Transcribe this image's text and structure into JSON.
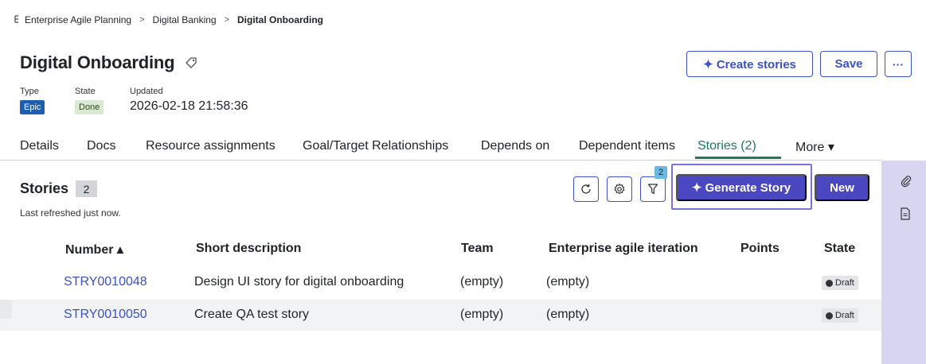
{
  "breadcrumb": {
    "items": [
      "Enterprise Agile Planning",
      "Digital Banking",
      "Digital Onboarding"
    ],
    "separator": ">"
  },
  "header": {
    "title": "Digital Onboarding",
    "create_stories_label": "✦ Create stories",
    "save_label": "Save",
    "more_label": "···",
    "type_label": "Type",
    "type_value": "Epic",
    "state_label": "State",
    "state_value": "Done",
    "updated_label": "Updated",
    "updated_value": "2026-02-18 21:58:36"
  },
  "tabs": [
    {
      "label": "Details"
    },
    {
      "label": "Docs"
    },
    {
      "label": "Resource assignments"
    },
    {
      "label": "Goal/Target Relationships"
    },
    {
      "label": "Depends on"
    },
    {
      "label": "Dependent items"
    },
    {
      "label": "Stories (2)",
      "active": true
    },
    {
      "label": "More ▾"
    }
  ],
  "stories": {
    "title": "Stories",
    "count": "2",
    "refreshed": "Last refreshed just now.",
    "filter_count": "2",
    "generate_label": "✦ Generate Story",
    "new_label": "New",
    "columns": [
      "Number ▴",
      "Short description",
      "Team",
      "Enterprise agile iteration",
      "Points",
      "State"
    ],
    "rows": [
      {
        "number": "STRY0010048",
        "description": "Design UI story for digital onboarding",
        "team": "(empty)",
        "iteration": "(empty)",
        "points": "",
        "state": "Draft"
      },
      {
        "number": "STRY0010050",
        "description": "Create QA test story",
        "team": "(empty)",
        "iteration": "(empty)",
        "points": "",
        "state": "Draft"
      }
    ]
  },
  "icons": {
    "breadcrumb": "hierarchy-icon",
    "tag": "tag-icon",
    "refresh": "refresh-icon",
    "settings": "gear-icon",
    "filter": "filter-icon",
    "attachment": "paperclip-icon",
    "document": "document-icon"
  },
  "colors": {
    "accent": "#3b52c4",
    "primary_button": "#4a47c0",
    "active_tab": "#1e7b5b",
    "rail": "#d7d5f0",
    "epic_badge": "#1a5fb4",
    "done_badge": "#dbe8d2"
  }
}
